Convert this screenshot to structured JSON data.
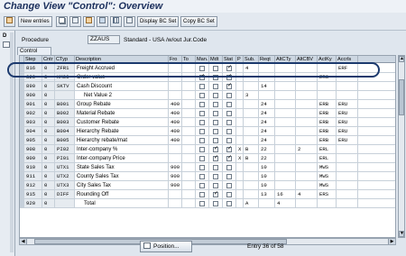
{
  "window": {
    "title": "Change View \"Control\": Overview"
  },
  "toolbar": {
    "new_entries": "New entries",
    "display_bc_set": "Display BC Set",
    "copy_bc_set": "Copy BC Set"
  },
  "left_pane": {
    "label": "D"
  },
  "header": {
    "procedure_label": "Procedure",
    "procedure_value": "ZZAUS",
    "procedure_desc": "Standard - USA /w/out Jur.Code"
  },
  "tab": {
    "label": "Control"
  },
  "columns": [
    "Step",
    "Cntr",
    "CTyp",
    "Description",
    "Fro",
    "To",
    "Man.",
    "Mdt",
    "Stat",
    "P",
    "Sub.",
    "Reqt",
    "AltCTy",
    "AltCBV",
    "ActKy",
    "Accrls"
  ],
  "rows": [
    {
      "step": "816",
      "cntr": "0",
      "ctyp": "ZFR1",
      "desc": "Freight Accrued",
      "fro": "",
      "to": "",
      "man": false,
      "mdt": false,
      "stat": true,
      "p": "",
      "sub": "4",
      "reqt": "",
      "altcty": "",
      "altcbv": "",
      "actky": "",
      "accrls": "ERF"
    },
    {
      "step": "820",
      "cntr": "0",
      "ctyp": "HM00",
      "desc": "Order value",
      "fro": "",
      "to": "",
      "man": true,
      "mdt": false,
      "stat": true,
      "p": "",
      "sub": "",
      "reqt": "",
      "altcty": "",
      "altcbv": "",
      "actky": "ERS",
      "accrls": ""
    },
    {
      "step": "890",
      "cntr": "0",
      "ctyp": "SKTV",
      "desc": "Cash Discount",
      "fro": "",
      "to": "",
      "man": false,
      "mdt": false,
      "stat": true,
      "p": "",
      "sub": "",
      "reqt": "14",
      "altcty": "",
      "altcbv": "",
      "actky": "",
      "accrls": ""
    },
    {
      "step": "900",
      "cntr": "0",
      "ctyp": "",
      "desc": "Net Value 2",
      "fro": "",
      "to": "",
      "man": false,
      "mdt": false,
      "stat": false,
      "p": "",
      "sub": "3",
      "reqt": "",
      "altcty": "",
      "altcbv": "",
      "actky": "",
      "accrls": ""
    },
    {
      "step": "901",
      "cntr": "0",
      "ctyp": "B001",
      "desc": "Group Rebate",
      "fro": "400",
      "to": "",
      "man": false,
      "mdt": false,
      "stat": false,
      "p": "",
      "sub": "",
      "reqt": "24",
      "altcty": "",
      "altcbv": "",
      "actky": "ERB",
      "accrls": "ERU"
    },
    {
      "step": "902",
      "cntr": "0",
      "ctyp": "B002",
      "desc": "Material Rebate",
      "fro": "400",
      "to": "",
      "man": false,
      "mdt": false,
      "stat": false,
      "p": "",
      "sub": "",
      "reqt": "24",
      "altcty": "",
      "altcbv": "",
      "actky": "ERB",
      "accrls": "ERU"
    },
    {
      "step": "903",
      "cntr": "0",
      "ctyp": "B003",
      "desc": "Customer Rebate",
      "fro": "400",
      "to": "",
      "man": false,
      "mdt": false,
      "stat": false,
      "p": "",
      "sub": "",
      "reqt": "24",
      "altcty": "",
      "altcbv": "",
      "actky": "ERB",
      "accrls": "ERU"
    },
    {
      "step": "904",
      "cntr": "0",
      "ctyp": "B004",
      "desc": "Hierarchy Rebate",
      "fro": "400",
      "to": "",
      "man": false,
      "mdt": false,
      "stat": false,
      "p": "",
      "sub": "",
      "reqt": "24",
      "altcty": "",
      "altcbv": "",
      "actky": "ERB",
      "accrls": "ERU"
    },
    {
      "step": "905",
      "cntr": "0",
      "ctyp": "B005",
      "desc": "Hierarchy rebate/mat",
      "fro": "400",
      "to": "",
      "man": false,
      "mdt": false,
      "stat": false,
      "p": "",
      "sub": "",
      "reqt": "24",
      "altcty": "",
      "altcbv": "",
      "actky": "ERB",
      "accrls": "ERU"
    },
    {
      "step": "908",
      "cntr": "0",
      "ctyp": "PI02",
      "desc": "Inter-company %",
      "fro": "",
      "to": "",
      "man": false,
      "mdt": true,
      "stat": true,
      "p": "X",
      "sub": "B",
      "reqt": "22",
      "altcty": "",
      "altcbv": "2",
      "actky": "ERL",
      "accrls": ""
    },
    {
      "step": "909",
      "cntr": "0",
      "ctyp": "PI01",
      "desc": "Inter-company Price",
      "fro": "",
      "to": "",
      "man": false,
      "mdt": true,
      "stat": true,
      "p": "X",
      "sub": "B",
      "reqt": "22",
      "altcty": "",
      "altcbv": "",
      "actky": "ERL",
      "accrls": ""
    },
    {
      "step": "910",
      "cntr": "0",
      "ctyp": "UTX1",
      "desc": "State Sales Tax",
      "fro": "900",
      "to": "",
      "man": false,
      "mdt": false,
      "stat": false,
      "p": "",
      "sub": "",
      "reqt": "10",
      "altcty": "",
      "altcbv": "",
      "actky": "MWS",
      "accrls": ""
    },
    {
      "step": "911",
      "cntr": "0",
      "ctyp": "UTX2",
      "desc": "County Sales Tax",
      "fro": "900",
      "to": "",
      "man": false,
      "mdt": false,
      "stat": false,
      "p": "",
      "sub": "",
      "reqt": "10",
      "altcty": "",
      "altcbv": "",
      "actky": "MWS",
      "accrls": ""
    },
    {
      "step": "912",
      "cntr": "0",
      "ctyp": "UTX3",
      "desc": "City Sales Tax",
      "fro": "900",
      "to": "",
      "man": false,
      "mdt": false,
      "stat": false,
      "p": "",
      "sub": "",
      "reqt": "10",
      "altcty": "",
      "altcbv": "",
      "actky": "MWS",
      "accrls": ""
    },
    {
      "step": "915",
      "cntr": "0",
      "ctyp": "DIFF",
      "desc": "Rounding Off",
      "fro": "",
      "to": "",
      "man": false,
      "mdt": true,
      "stat": false,
      "p": "",
      "sub": "",
      "reqt": "13",
      "altcty": "16",
      "altcbv": "4",
      "actky": "ERS",
      "accrls": ""
    },
    {
      "step": "920",
      "cntr": "0",
      "ctyp": "",
      "desc": "Total",
      "fro": "",
      "to": "",
      "man": false,
      "mdt": false,
      "stat": false,
      "p": "",
      "sub": "A",
      "reqt": "",
      "altcty": "4",
      "altcbv": "",
      "actky": "",
      "accrls": ""
    }
  ],
  "footer": {
    "position_button": "Position...",
    "entry_text": "Entry 36 of 58"
  }
}
